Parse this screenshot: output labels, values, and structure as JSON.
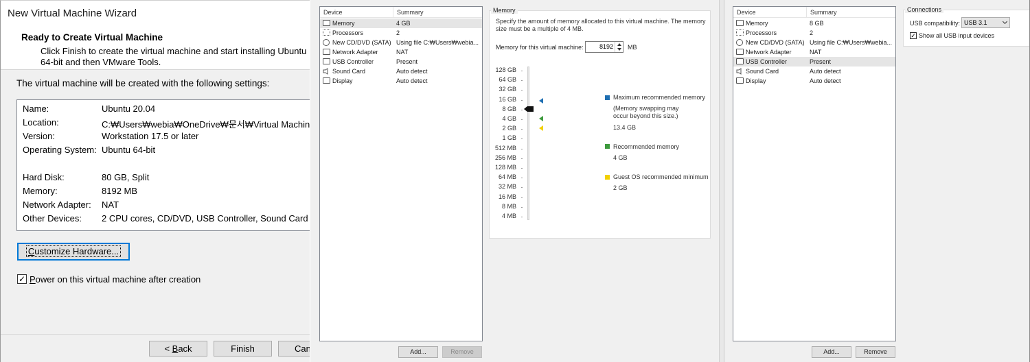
{
  "wizard": {
    "window_title": "New Virtual Machine Wizard",
    "header_title": "Ready to Create Virtual Machine",
    "header_desc": "Click Finish to create the virtual machine and start installing Ubuntu 64-bit and then VMware Tools.",
    "intro": "The virtual machine will be created with the following settings:",
    "summary": [
      {
        "k": "Name:",
        "v": "Ubuntu 20.04"
      },
      {
        "k": "Location:",
        "v": "C:₩Users₩webia₩OneDrive₩문서₩Virtual Machin"
      },
      {
        "k": "Version:",
        "v": "Workstation 17.5 or later"
      },
      {
        "k": "Operating System:",
        "v": "Ubuntu 64-bit"
      },
      {
        "k": "Hard Disk:",
        "v": "80 GB, Split"
      },
      {
        "k": "Memory:",
        "v": "8192 MB"
      },
      {
        "k": "Network Adapter:",
        "v": "NAT"
      },
      {
        "k": "Other Devices:",
        "v": "2 CPU cores, CD/DVD, USB Controller, Sound Card"
      }
    ],
    "customize_pre": "C",
    "customize_rest": "ustomize Hardware...",
    "power_checked": "✓",
    "power_pre": "P",
    "power_rest": "ower on this virtual machine after creation",
    "back_pre": "< ",
    "back_u": "B",
    "back_rest": "ack",
    "finish": "Finish",
    "cancel": "Can"
  },
  "device_list": {
    "col_device": "Device",
    "col_summary": "Summary"
  },
  "panel1": {
    "devices": [
      {
        "name": "Memory",
        "summary": "4 GB",
        "icon": "memory-icon"
      },
      {
        "name": "Processors",
        "summary": "2",
        "icon": "processor-icon"
      },
      {
        "name": "New CD/DVD (SATA)",
        "summary": "Using file C:₩Users₩webia...",
        "icon": "cd-dvd-icon"
      },
      {
        "name": "Network Adapter",
        "summary": "NAT",
        "icon": "network-icon"
      },
      {
        "name": "USB Controller",
        "summary": "Present",
        "icon": "usb-icon"
      },
      {
        "name": "Sound Card",
        "summary": "Auto detect",
        "icon": "speaker-icon"
      },
      {
        "name": "Display",
        "summary": "Auto detect",
        "icon": "display-icon"
      }
    ],
    "add": "Add...",
    "remove": "Remove",
    "memory": {
      "group_title": "Memory",
      "desc": "Specify the amount of memory allocated to this virtual machine. The memory size must be a multiple of 4 MB.",
      "label": "Memory for this virtual machine:",
      "value": "8192",
      "unit": "MB",
      "ticks": [
        "128 GB",
        "64 GB",
        "32 GB",
        "16 GB",
        "8 GB",
        "4 GB",
        "2 GB",
        "1 GB",
        "512 MB",
        "256 MB",
        "128 MB",
        "64 MB",
        "32 MB",
        "16 MB",
        "8 MB",
        "4 MB"
      ],
      "max_title": "Maximum recommended memory",
      "max_note": "(Memory swapping may occur beyond this size.)",
      "max_value": "13.4 GB",
      "rec_title": "Recommended memory",
      "rec_value": "4 GB",
      "min_title": "Guest OS recommended minimum",
      "min_value": "2 GB",
      "colors": {
        "max": "#1f6fb2",
        "rec": "#3d9a3d",
        "min": "#f2d000"
      }
    }
  },
  "panel2": {
    "devices": [
      {
        "name": "Memory",
        "summary": "8 GB",
        "icon": "memory-icon"
      },
      {
        "name": "Processors",
        "summary": "2",
        "icon": "processor-icon"
      },
      {
        "name": "New CD/DVD (SATA)",
        "summary": "Using file C:₩Users₩webia...",
        "icon": "cd-dvd-icon"
      },
      {
        "name": "Network Adapter",
        "summary": "NAT",
        "icon": "network-icon"
      },
      {
        "name": "USB Controller",
        "summary": "Present",
        "icon": "usb-icon"
      },
      {
        "name": "Sound Card",
        "summary": "Auto detect",
        "icon": "speaker-icon"
      },
      {
        "name": "Display",
        "summary": "Auto detect",
        "icon": "display-icon"
      }
    ],
    "add": "Add...",
    "remove": "Remove",
    "connections": {
      "group_title": "Connections",
      "usb_label": "USB compatibility:",
      "usb_value": "USB 3.1",
      "show_all_checked": "✓",
      "show_all": "Show all USB input devices"
    }
  }
}
